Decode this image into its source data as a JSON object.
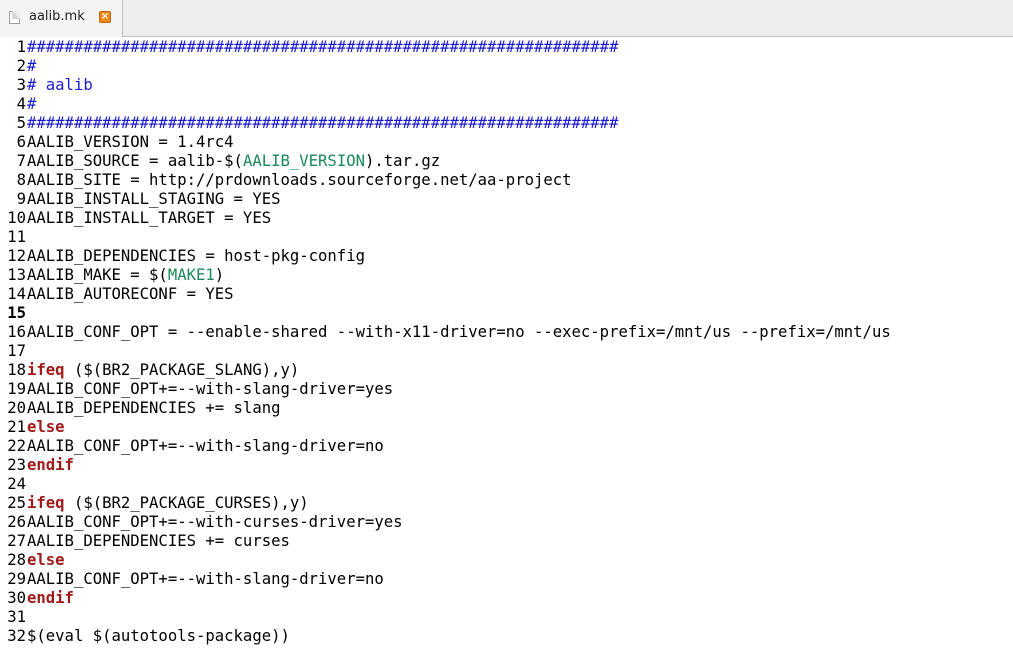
{
  "tab": {
    "title": "aalib.mk",
    "close_glyph": "×"
  },
  "colors": {
    "comment": "#1a1ad2",
    "keyword": "#a01a1a",
    "variable": "#1a8a5a",
    "text": "#000000"
  },
  "editor": {
    "current_line": 15,
    "lines": [
      {
        "no": "1",
        "tokens": [
          {
            "t": "comment",
            "v": "###############################################################"
          }
        ]
      },
      {
        "no": "2",
        "tokens": [
          {
            "t": "comment",
            "v": "#"
          }
        ]
      },
      {
        "no": "3",
        "tokens": [
          {
            "t": "comment",
            "v": "# aalib"
          }
        ]
      },
      {
        "no": "4",
        "tokens": [
          {
            "t": "comment",
            "v": "#"
          }
        ]
      },
      {
        "no": "5",
        "tokens": [
          {
            "t": "comment",
            "v": "###############################################################"
          }
        ]
      },
      {
        "no": "6",
        "tokens": [
          {
            "t": "plain",
            "v": "AALIB_VERSION = 1.4rc4"
          }
        ]
      },
      {
        "no": "7",
        "tokens": [
          {
            "t": "plain",
            "v": "AALIB_SOURCE = aalib-$("
          },
          {
            "t": "var",
            "v": "AALIB_VERSION"
          },
          {
            "t": "plain",
            "v": ").tar.gz"
          }
        ]
      },
      {
        "no": "8",
        "tokens": [
          {
            "t": "plain",
            "v": "AALIB_SITE = http://prdownloads.sourceforge.net/aa-project"
          }
        ]
      },
      {
        "no": "9",
        "tokens": [
          {
            "t": "plain",
            "v": "AALIB_INSTALL_STAGING = YES"
          }
        ]
      },
      {
        "no": "10",
        "tokens": [
          {
            "t": "plain",
            "v": "AALIB_INSTALL_TARGET = YES"
          }
        ]
      },
      {
        "no": "11",
        "tokens": []
      },
      {
        "no": "12",
        "tokens": [
          {
            "t": "plain",
            "v": "AALIB_DEPENDENCIES = host-pkg-config"
          }
        ]
      },
      {
        "no": "13",
        "tokens": [
          {
            "t": "plain",
            "v": "AALIB_MAKE = $("
          },
          {
            "t": "var",
            "v": "MAKE1"
          },
          {
            "t": "plain",
            "v": ")"
          }
        ]
      },
      {
        "no": "14",
        "tokens": [
          {
            "t": "plain",
            "v": "AALIB_AUTORECONF = YES"
          }
        ]
      },
      {
        "no": "15",
        "tokens": []
      },
      {
        "no": "16",
        "tokens": [
          {
            "t": "plain",
            "v": "AALIB_CONF_OPT = --enable-shared --with-x11-driver=no --exec-prefix=/mnt/us --prefix=/mnt/us"
          }
        ]
      },
      {
        "no": "17",
        "tokens": []
      },
      {
        "no": "18",
        "tokens": [
          {
            "t": "keyword",
            "v": "ifeq"
          },
          {
            "t": "plain",
            "v": " ($(BR2_PACKAGE_SLANG),y)"
          }
        ]
      },
      {
        "no": "19",
        "tokens": [
          {
            "t": "plain",
            "v": "AALIB_CONF_OPT+=--with-slang-driver=yes"
          }
        ]
      },
      {
        "no": "20",
        "tokens": [
          {
            "t": "plain",
            "v": "AALIB_DEPENDENCIES += slang"
          }
        ]
      },
      {
        "no": "21",
        "tokens": [
          {
            "t": "keyword",
            "v": "else"
          }
        ]
      },
      {
        "no": "22",
        "tokens": [
          {
            "t": "plain",
            "v": "AALIB_CONF_OPT+=--with-slang-driver=no"
          }
        ]
      },
      {
        "no": "23",
        "tokens": [
          {
            "t": "keyword",
            "v": "endif"
          }
        ]
      },
      {
        "no": "24",
        "tokens": []
      },
      {
        "no": "25",
        "tokens": [
          {
            "t": "keyword",
            "v": "ifeq"
          },
          {
            "t": "plain",
            "v": " ($(BR2_PACKAGE_CURSES),y)"
          }
        ]
      },
      {
        "no": "26",
        "tokens": [
          {
            "t": "plain",
            "v": "AALIB_CONF_OPT+=--with-curses-driver=yes"
          }
        ]
      },
      {
        "no": "27",
        "tokens": [
          {
            "t": "plain",
            "v": "AALIB_DEPENDENCIES += curses"
          }
        ]
      },
      {
        "no": "28",
        "tokens": [
          {
            "t": "keyword",
            "v": "else"
          }
        ]
      },
      {
        "no": "29",
        "tokens": [
          {
            "t": "plain",
            "v": "AALIB_CONF_OPT+=--with-slang-driver=no"
          }
        ]
      },
      {
        "no": "30",
        "tokens": [
          {
            "t": "keyword",
            "v": "endif"
          }
        ]
      },
      {
        "no": "31",
        "tokens": []
      },
      {
        "no": "32",
        "tokens": [
          {
            "t": "plain",
            "v": "$(eval $(autotools-package))"
          }
        ]
      }
    ]
  }
}
